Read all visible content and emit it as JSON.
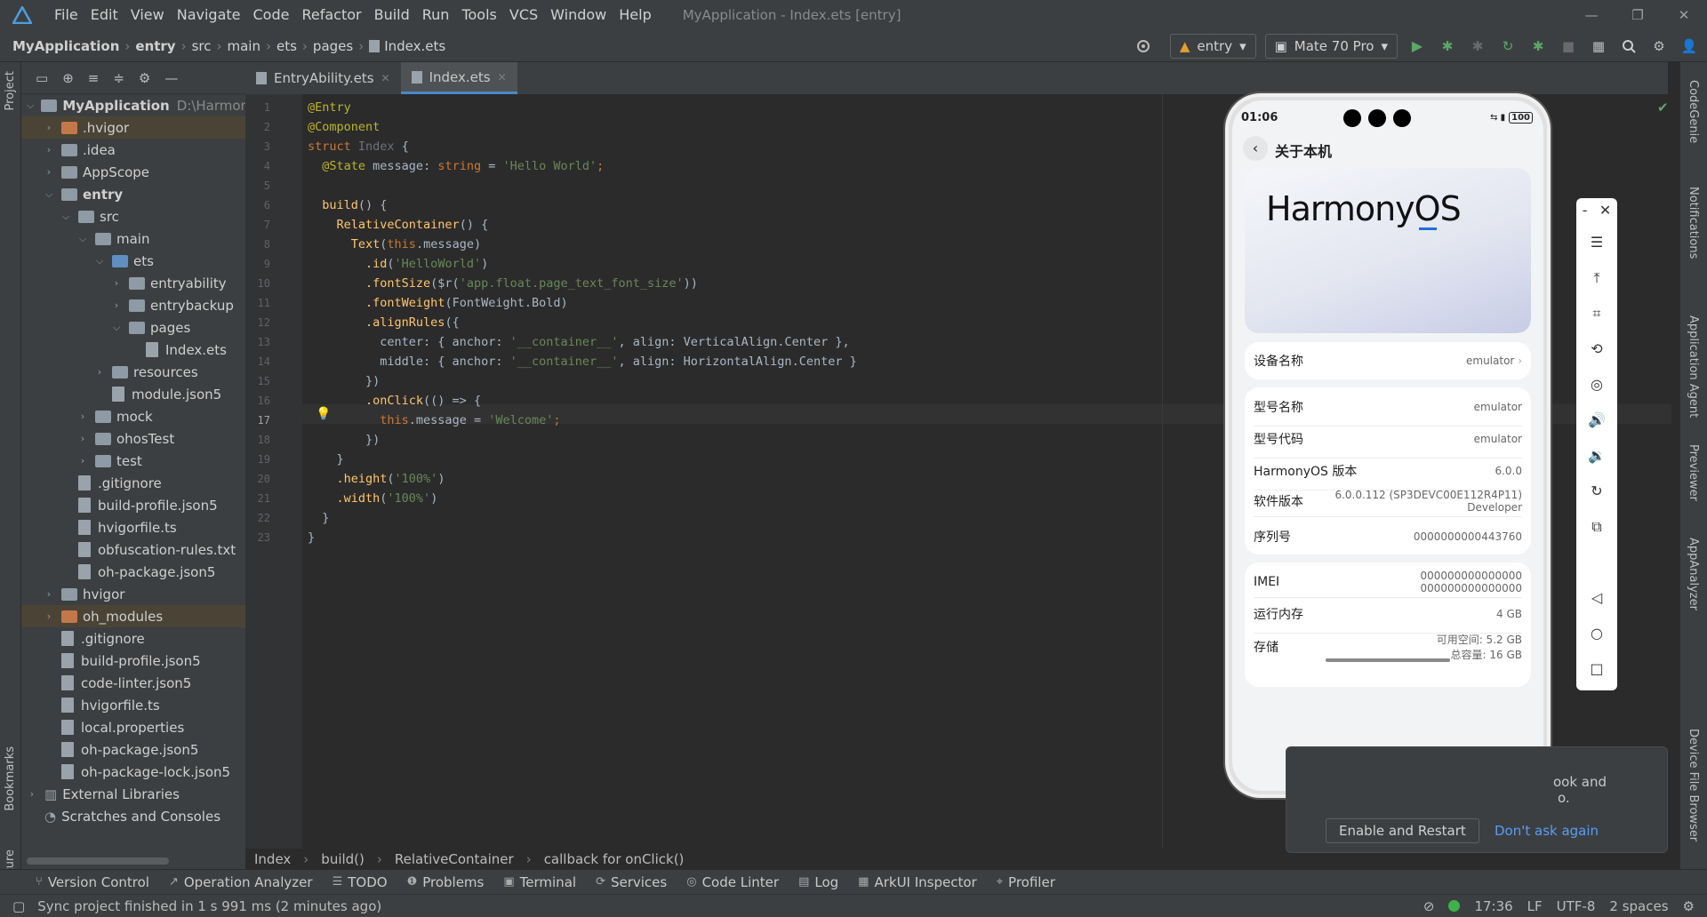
{
  "titlebar": {
    "menus": [
      "File",
      "Edit",
      "View",
      "Navigate",
      "Code",
      "Refactor",
      "Build",
      "Run",
      "Tools",
      "VCS",
      "Window",
      "Help"
    ],
    "title": "MyApplication - Index.ets [entry]"
  },
  "nav": {
    "crumbs": [
      "MyApplication",
      "entry",
      "src",
      "main",
      "ets",
      "pages",
      "Index.ets"
    ],
    "config": "entry",
    "device": "Mate 70 Pro"
  },
  "strip": {
    "project": "Project",
    "bookmarks": "Bookmarks",
    "structure": "Structure"
  },
  "tree": [
    {
      "label": "MyApplication",
      "extra": "D:\\Harmony",
      "depth": 0,
      "arrow": "v",
      "kind": "module",
      "bold": true
    },
    {
      "label": ".hvigor",
      "depth": 1,
      "arrow": ">",
      "kind": "orange",
      "sel": true
    },
    {
      "label": ".idea",
      "depth": 1,
      "arrow": ">",
      "kind": "folder"
    },
    {
      "label": "AppScope",
      "depth": 1,
      "arrow": ">",
      "kind": "folder"
    },
    {
      "label": "entry",
      "depth": 1,
      "arrow": "v",
      "kind": "module",
      "bold": true
    },
    {
      "label": "src",
      "depth": 2,
      "arrow": "v",
      "kind": "folder"
    },
    {
      "label": "main",
      "depth": 3,
      "arrow": "v",
      "kind": "folder"
    },
    {
      "label": "ets",
      "depth": 4,
      "arrow": "v",
      "kind": "blue"
    },
    {
      "label": "entryability",
      "depth": 5,
      "arrow": ">",
      "kind": "folder"
    },
    {
      "label": "entrybackup",
      "depth": 5,
      "arrow": ">",
      "kind": "folder"
    },
    {
      "label": "pages",
      "depth": 5,
      "arrow": "v",
      "kind": "folder"
    },
    {
      "label": "Index.ets",
      "depth": 6,
      "arrow": "",
      "kind": "file"
    },
    {
      "label": "resources",
      "depth": 4,
      "arrow": ">",
      "kind": "folder"
    },
    {
      "label": "module.json5",
      "depth": 4,
      "arrow": "",
      "kind": "file"
    },
    {
      "label": "mock",
      "depth": 3,
      "arrow": ">",
      "kind": "folder"
    },
    {
      "label": "ohosTest",
      "depth": 3,
      "arrow": ">",
      "kind": "folder"
    },
    {
      "label": "test",
      "depth": 3,
      "arrow": ">",
      "kind": "folder"
    },
    {
      "label": ".gitignore",
      "depth": 2,
      "arrow": "",
      "kind": "file"
    },
    {
      "label": "build-profile.json5",
      "depth": 2,
      "arrow": "",
      "kind": "file"
    },
    {
      "label": "hvigorfile.ts",
      "depth": 2,
      "arrow": "",
      "kind": "file"
    },
    {
      "label": "obfuscation-rules.txt",
      "depth": 2,
      "arrow": "",
      "kind": "file"
    },
    {
      "label": "oh-package.json5",
      "depth": 2,
      "arrow": "",
      "kind": "file"
    },
    {
      "label": "hvigor",
      "depth": 1,
      "arrow": ">",
      "kind": "folder"
    },
    {
      "label": "oh_modules",
      "depth": 1,
      "arrow": ">",
      "kind": "orange",
      "sel": true
    },
    {
      "label": ".gitignore",
      "depth": 1,
      "arrow": "",
      "kind": "file"
    },
    {
      "label": "build-profile.json5",
      "depth": 1,
      "arrow": "",
      "kind": "file"
    },
    {
      "label": "code-linter.json5",
      "depth": 1,
      "arrow": "",
      "kind": "file"
    },
    {
      "label": "hvigorfile.ts",
      "depth": 1,
      "arrow": "",
      "kind": "file"
    },
    {
      "label": "local.properties",
      "depth": 1,
      "arrow": "",
      "kind": "file"
    },
    {
      "label": "oh-package.json5",
      "depth": 1,
      "arrow": "",
      "kind": "file"
    },
    {
      "label": "oh-package-lock.json5",
      "depth": 1,
      "arrow": "",
      "kind": "file"
    },
    {
      "label": "External Libraries",
      "depth": 0,
      "arrow": ">",
      "kind": "lib"
    },
    {
      "label": "Scratches and Consoles",
      "depth": 0,
      "arrow": "",
      "kind": "scratch"
    }
  ],
  "tabs": [
    {
      "label": "EntryAbility.ets",
      "active": false
    },
    {
      "label": "Index.ets",
      "active": true
    }
  ],
  "code": [
    [
      [
        "@Entry",
        "#bbb529"
      ]
    ],
    [
      [
        "@Component",
        "#bbb529"
      ]
    ],
    [
      [
        "struct ",
        "#cc7832"
      ],
      [
        "Index ",
        "#6f737a"
      ],
      [
        "{",
        "#a9b7c6"
      ]
    ],
    [
      [
        "  @State ",
        "#bbb529"
      ],
      [
        "message",
        "#a9b7c6"
      ],
      [
        ": ",
        "#a9b7c6"
      ],
      [
        "string",
        "#cc7832"
      ],
      [
        " = ",
        "#a9b7c6"
      ],
      [
        "'Hello World'",
        "#6a8759"
      ],
      [
        ";",
        "#cc7832"
      ]
    ],
    [
      [
        "",
        ""
      ]
    ],
    [
      [
        "  build",
        "#ffc66d"
      ],
      [
        "() {",
        "#a9b7c6"
      ]
    ],
    [
      [
        "    RelativeContainer",
        "#ffc66d"
      ],
      [
        "() {",
        "#a9b7c6"
      ]
    ],
    [
      [
        "      Text",
        "#ffc66d"
      ],
      [
        "(",
        "#a9b7c6"
      ],
      [
        "this",
        "#cc7832"
      ],
      [
        ".message)",
        "#a9b7c6"
      ]
    ],
    [
      [
        "        .id",
        "#ffc66d"
      ],
      [
        "(",
        "#a9b7c6"
      ],
      [
        "'HelloWorld'",
        "#6a8759"
      ],
      [
        ")",
        "#a9b7c6"
      ]
    ],
    [
      [
        "        .fontSize",
        "#ffc66d"
      ],
      [
        "($r(",
        "#a9b7c6"
      ],
      [
        "'app.float.page_text_font_size'",
        "#6a8759"
      ],
      [
        "))",
        "#a9b7c6"
      ]
    ],
    [
      [
        "        .fontWeight",
        "#ffc66d"
      ],
      [
        "(FontWeight.Bold)",
        "#a9b7c6"
      ]
    ],
    [
      [
        "        .alignRules",
        "#ffc66d"
      ],
      [
        "({",
        "#a9b7c6"
      ]
    ],
    [
      [
        "          center: { anchor: ",
        "#a9b7c6"
      ],
      [
        "'__container__'",
        "#6a8759"
      ],
      [
        ", align: VerticalAlign.Center },",
        "#a9b7c6"
      ]
    ],
    [
      [
        "          middle: { anchor: ",
        "#a9b7c6"
      ],
      [
        "'__container__'",
        "#6a8759"
      ],
      [
        ", align: HorizontalAlign.Center }",
        "#a9b7c6"
      ]
    ],
    [
      [
        "        })",
        "#a9b7c6"
      ]
    ],
    [
      [
        "        .onClick",
        "#ffc66d"
      ],
      [
        "(() => {",
        "#a9b7c6"
      ]
    ],
    [
      [
        "          this",
        "#cc7832"
      ],
      [
        ".message = ",
        "#a9b7c6"
      ],
      [
        "'Welcome'",
        "#6a8759"
      ],
      [
        ";",
        "#cc7832"
      ]
    ],
    [
      [
        "        })",
        "#a9b7c6"
      ]
    ],
    [
      [
        "    }",
        "#a9b7c6"
      ]
    ],
    [
      [
        "    .height",
        "#ffc66d"
      ],
      [
        "(",
        "#a9b7c6"
      ],
      [
        "'100%'",
        "#6a8759"
      ],
      [
        ")",
        "#a9b7c6"
      ]
    ],
    [
      [
        "    .width",
        "#ffc66d"
      ],
      [
        "(",
        "#a9b7c6"
      ],
      [
        "'100%'",
        "#6a8759"
      ],
      [
        ")",
        "#a9b7c6"
      ]
    ],
    [
      [
        "  }",
        "#a9b7c6"
      ]
    ],
    [
      [
        "}",
        "#a9b7c6"
      ]
    ]
  ],
  "editor_breadcrumb": [
    "Index",
    "build()",
    "RelativeContainer",
    "callback for onClick()"
  ],
  "phone": {
    "time": "01:06",
    "battery": "100",
    "header": "关于本机",
    "brand": "HarmonyOS",
    "device_name": {
      "label": "设备名称",
      "value": "emulator"
    },
    "rows1": [
      {
        "label": "型号名称",
        "value": "emulator"
      },
      {
        "label": "型号代码",
        "value": "emulator"
      },
      {
        "label": "HarmonyOS 版本",
        "value": "6.0.0"
      },
      {
        "label": "软件版本",
        "value": "6.0.0.112 (SP3DEVC00E112R4P11)",
        "value2": "Developer"
      },
      {
        "label": "序列号",
        "value": "0000000000443760"
      }
    ],
    "rows2": [
      {
        "label": "IMEI",
        "value": "000000000000000",
        "value2": "000000000000000"
      },
      {
        "label": "运行内存",
        "value": "4 GB"
      },
      {
        "label": "存储",
        "value": "可用空间:  5.2 GB",
        "value2": "总容量:  16 GB"
      }
    ]
  },
  "notif": {
    "text1": "ook and",
    "text2": "o.",
    "enable": "Enable and Restart",
    "dont": "Don't ask again"
  },
  "rightstrip": [
    "CodeGenie",
    "Notifications",
    "Application Agent",
    "Previewer",
    "AppAnalyzer",
    "Device File Browser"
  ],
  "bottom": [
    "Version Control",
    "Operation Analyzer",
    "TODO",
    "Problems",
    "Terminal",
    "Services",
    "Code Linter",
    "Log",
    "ArkUI Inspector",
    "Profiler"
  ],
  "status": {
    "message": "Sync project finished in 1 s 991 ms (2 minutes ago)",
    "time": "17:36",
    "lf": "LF",
    "enc": "UTF-8",
    "indent": "2 spaces"
  }
}
